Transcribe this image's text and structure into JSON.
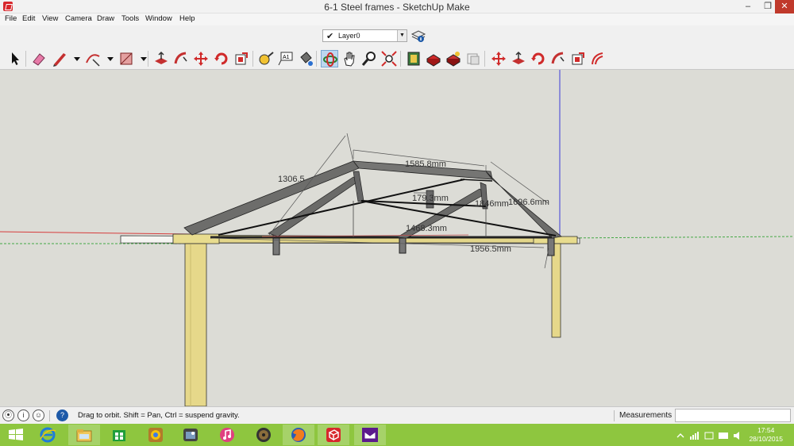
{
  "window": {
    "title": "6-1 Steel frames - SketchUp Make",
    "min_glyph": "–",
    "max_glyph": "❐",
    "close_glyph": "✕"
  },
  "menu": {
    "items": [
      "File",
      "Edit",
      "View",
      "Camera",
      "Draw",
      "Tools",
      "Window",
      "Help"
    ]
  },
  "layers": {
    "current": "Layer0",
    "check_glyph": "✔",
    "arrow_glyph": "▼"
  },
  "toolbar": {
    "icons": [
      "select-icon",
      "eraser-icon",
      "pencil-icon",
      "arc-icon",
      "rectangle-icon",
      "push-pull-icon",
      "follow-me-icon",
      "move-icon",
      "rotate-icon",
      "scale-icon",
      "tape-measure-icon",
      "text-icon",
      "paint-bucket-icon",
      "orbit-icon",
      "pan-icon",
      "zoom-icon",
      "zoom-extents-icon",
      "3d-warehouse-icon",
      "components-icon",
      "extension-warehouse-icon",
      "layout-icon",
      "move-icon",
      "push-pull-icon",
      "rotate-icon",
      "follow-me-icon",
      "scale-icon",
      "offset-icon"
    ]
  },
  "dimensions": {
    "d1": "1306.5",
    "d2": "1585.8mm",
    "d3": "179.3mm",
    "d4": "1846mm",
    "d5": "1696.6mm",
    "d6": "1468.3mm",
    "d7": "1956.5mm"
  },
  "status": {
    "hint": "Drag to orbit. Shift = Pan, Ctrl = suspend gravity.",
    "measurements_label": "Measurements",
    "measurements_value": "",
    "info_glyph": "i",
    "help_glyph": "?"
  },
  "taskbar": {
    "apps": [
      "start-icon",
      "internet-explorer-icon",
      "file-explorer-icon",
      "store-icon",
      "chrome-icon",
      "photos-icon",
      "itunes-icon",
      "media-player-icon",
      "firefox-icon",
      "sketchup-icon",
      "yahoo-mail-icon"
    ],
    "time": "17:54",
    "date": "28/10/2015"
  },
  "colors": {
    "sky": "#dcdcd6",
    "steel": "#6d6d6b",
    "timber": "#e3d68a",
    "red_axis": "#d63c3c",
    "green_axis": "#45a845",
    "blue_axis": "#3b3bd8",
    "taskbar": "#8ec63f"
  }
}
